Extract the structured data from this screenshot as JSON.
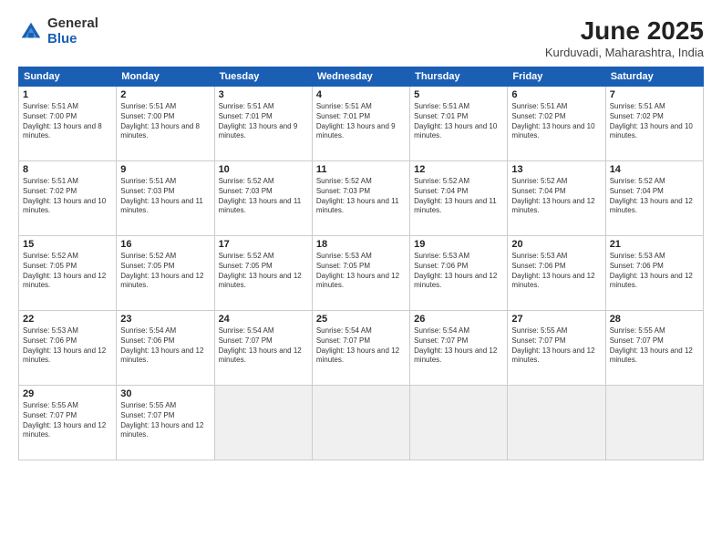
{
  "header": {
    "logo": {
      "general": "General",
      "blue": "Blue"
    },
    "title": "June 2025",
    "subtitle": "Kurduvadi, Maharashtra, India"
  },
  "calendar": {
    "weekdays": [
      "Sunday",
      "Monday",
      "Tuesday",
      "Wednesday",
      "Thursday",
      "Friday",
      "Saturday"
    ],
    "weeks": [
      [
        null,
        {
          "day": 2,
          "sunrise": "5:51 AM",
          "sunset": "7:00 PM",
          "daylight": "13 hours and 8 minutes."
        },
        {
          "day": 3,
          "sunrise": "5:51 AM",
          "sunset": "7:01 PM",
          "daylight": "13 hours and 9 minutes."
        },
        {
          "day": 4,
          "sunrise": "5:51 AM",
          "sunset": "7:01 PM",
          "daylight": "13 hours and 9 minutes."
        },
        {
          "day": 5,
          "sunrise": "5:51 AM",
          "sunset": "7:01 PM",
          "daylight": "13 hours and 10 minutes."
        },
        {
          "day": 6,
          "sunrise": "5:51 AM",
          "sunset": "7:02 PM",
          "daylight": "13 hours and 10 minutes."
        },
        {
          "day": 7,
          "sunrise": "5:51 AM",
          "sunset": "7:02 PM",
          "daylight": "13 hours and 10 minutes."
        }
      ],
      [
        {
          "day": 1,
          "sunrise": "5:51 AM",
          "sunset": "7:00 PM",
          "daylight": "13 hours and 8 minutes."
        },
        {
          "day": 9,
          "sunrise": "5:51 AM",
          "sunset": "7:03 PM",
          "daylight": "13 hours and 11 minutes."
        },
        {
          "day": 10,
          "sunrise": "5:52 AM",
          "sunset": "7:03 PM",
          "daylight": "13 hours and 11 minutes."
        },
        {
          "day": 11,
          "sunrise": "5:52 AM",
          "sunset": "7:03 PM",
          "daylight": "13 hours and 11 minutes."
        },
        {
          "day": 12,
          "sunrise": "5:52 AM",
          "sunset": "7:04 PM",
          "daylight": "13 hours and 11 minutes."
        },
        {
          "day": 13,
          "sunrise": "5:52 AM",
          "sunset": "7:04 PM",
          "daylight": "13 hours and 12 minutes."
        },
        {
          "day": 14,
          "sunrise": "5:52 AM",
          "sunset": "7:04 PM",
          "daylight": "13 hours and 12 minutes."
        }
      ],
      [
        {
          "day": 8,
          "sunrise": "5:51 AM",
          "sunset": "7:02 PM",
          "daylight": "13 hours and 10 minutes."
        },
        {
          "day": 16,
          "sunrise": "5:52 AM",
          "sunset": "7:05 PM",
          "daylight": "13 hours and 12 minutes."
        },
        {
          "day": 17,
          "sunrise": "5:52 AM",
          "sunset": "7:05 PM",
          "daylight": "13 hours and 12 minutes."
        },
        {
          "day": 18,
          "sunrise": "5:53 AM",
          "sunset": "7:05 PM",
          "daylight": "13 hours and 12 minutes."
        },
        {
          "day": 19,
          "sunrise": "5:53 AM",
          "sunset": "7:06 PM",
          "daylight": "13 hours and 12 minutes."
        },
        {
          "day": 20,
          "sunrise": "5:53 AM",
          "sunset": "7:06 PM",
          "daylight": "13 hours and 12 minutes."
        },
        {
          "day": 21,
          "sunrise": "5:53 AM",
          "sunset": "7:06 PM",
          "daylight": "13 hours and 12 minutes."
        }
      ],
      [
        {
          "day": 15,
          "sunrise": "5:52 AM",
          "sunset": "7:05 PM",
          "daylight": "13 hours and 12 minutes."
        },
        {
          "day": 23,
          "sunrise": "5:54 AM",
          "sunset": "7:06 PM",
          "daylight": "13 hours and 12 minutes."
        },
        {
          "day": 24,
          "sunrise": "5:54 AM",
          "sunset": "7:07 PM",
          "daylight": "13 hours and 12 minutes."
        },
        {
          "day": 25,
          "sunrise": "5:54 AM",
          "sunset": "7:07 PM",
          "daylight": "13 hours and 12 minutes."
        },
        {
          "day": 26,
          "sunrise": "5:54 AM",
          "sunset": "7:07 PM",
          "daylight": "13 hours and 12 minutes."
        },
        {
          "day": 27,
          "sunrise": "5:55 AM",
          "sunset": "7:07 PM",
          "daylight": "13 hours and 12 minutes."
        },
        {
          "day": 28,
          "sunrise": "5:55 AM",
          "sunset": "7:07 PM",
          "daylight": "13 hours and 12 minutes."
        }
      ],
      [
        {
          "day": 22,
          "sunrise": "5:53 AM",
          "sunset": "7:06 PM",
          "daylight": "13 hours and 12 minutes."
        },
        {
          "day": 30,
          "sunrise": "5:55 AM",
          "sunset": "7:07 PM",
          "daylight": "13 hours and 12 minutes."
        },
        null,
        null,
        null,
        null,
        null
      ],
      [
        {
          "day": 29,
          "sunrise": "5:55 AM",
          "sunset": "7:07 PM",
          "daylight": "13 hours and 12 minutes."
        },
        null,
        null,
        null,
        null,
        null,
        null
      ]
    ]
  },
  "labels": {
    "sunrise": "Sunrise:",
    "sunset": "Sunset:",
    "daylight": "Daylight:"
  }
}
